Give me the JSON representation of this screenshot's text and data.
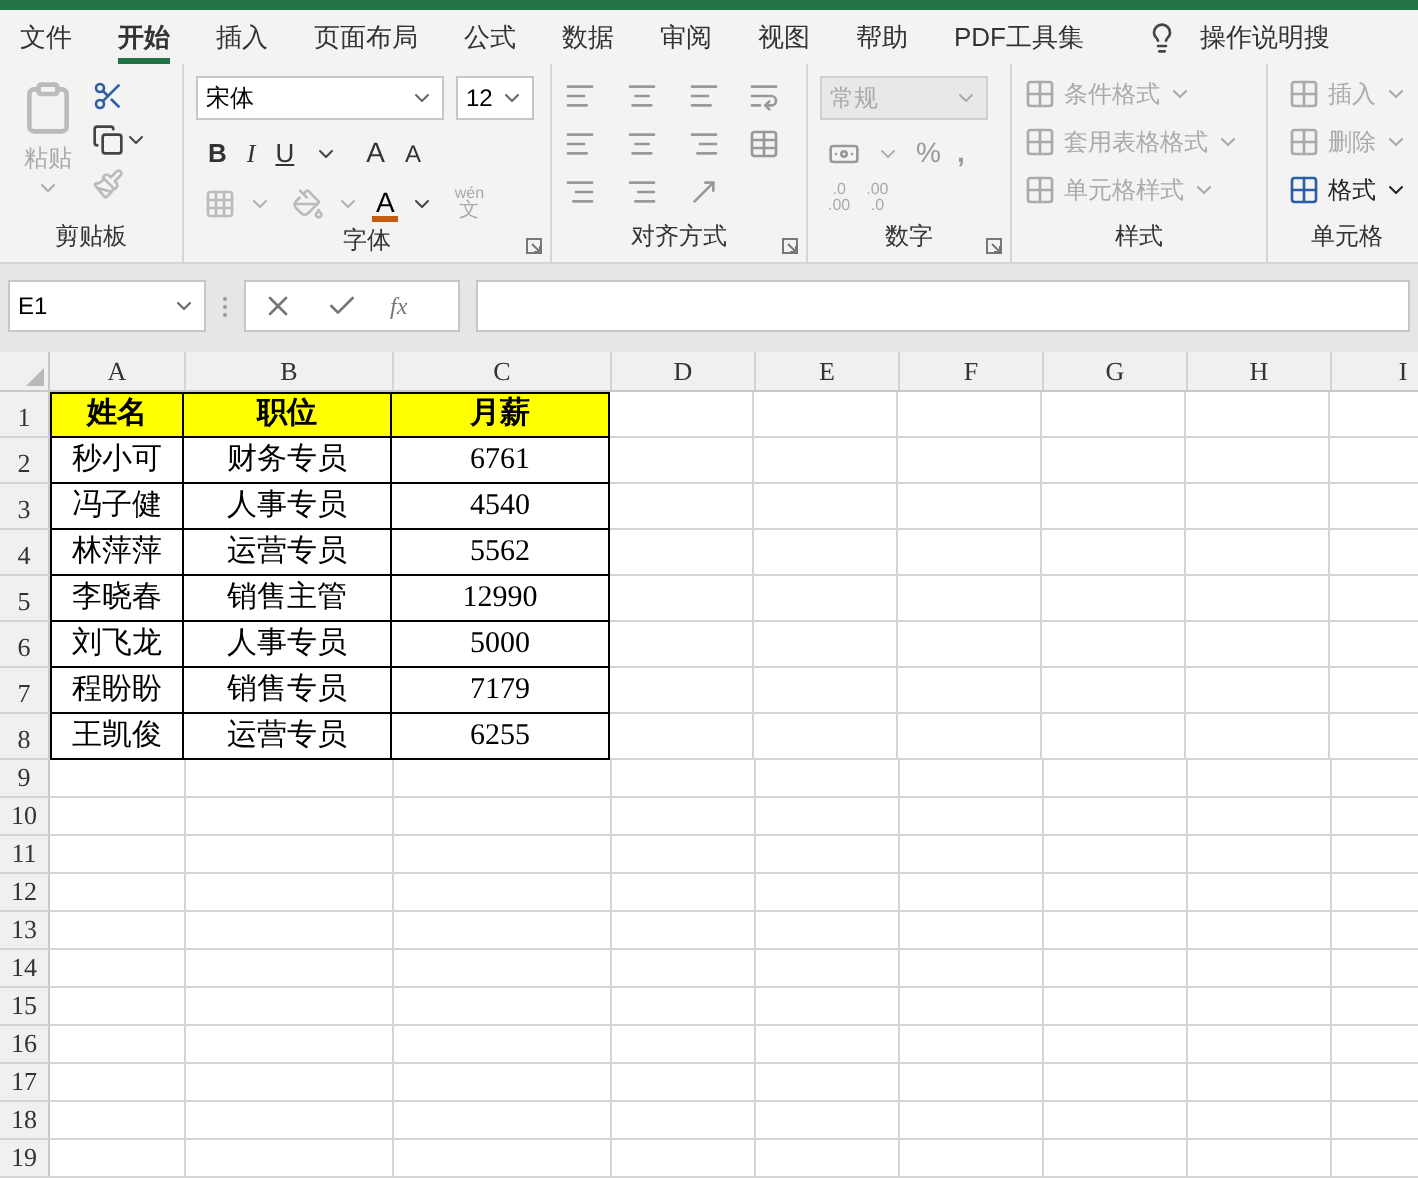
{
  "tabs": [
    {
      "label": "文件",
      "selected": false
    },
    {
      "label": "开始",
      "selected": true
    },
    {
      "label": "插入",
      "selected": false
    },
    {
      "label": "页面布局",
      "selected": false
    },
    {
      "label": "公式",
      "selected": false
    },
    {
      "label": "数据",
      "selected": false
    },
    {
      "label": "审阅",
      "selected": false
    },
    {
      "label": "视图",
      "selected": false
    },
    {
      "label": "帮助",
      "selected": false
    },
    {
      "label": "PDF工具集",
      "selected": false
    }
  ],
  "tell_me": "操作说明搜",
  "ribbon": {
    "clipboard": {
      "label": "剪贴板",
      "paste": "粘贴"
    },
    "font": {
      "label": "字体",
      "font_name": "宋体",
      "font_size": "12",
      "bold": "B",
      "italic": "I",
      "underline": "U",
      "grow": "A",
      "shrink": "A",
      "font_color": "A",
      "phonetic_top": "wén",
      "phonetic_bottom": "文"
    },
    "alignment": {
      "label": "对齐方式"
    },
    "number": {
      "label": "数字",
      "format": "常规",
      "percent": "%",
      "comma": ",",
      "increase_decimal": [
        ".0",
        ".00"
      ],
      "decrease_decimal": [
        ".00",
        ".0"
      ]
    },
    "styles": {
      "label": "样式",
      "items": [
        {
          "label": "条件格式",
          "disabled": true
        },
        {
          "label": "套用表格格式",
          "disabled": true
        },
        {
          "label": "单元格样式",
          "disabled": true
        }
      ]
    },
    "cells": {
      "label": "单元格",
      "items": [
        {
          "label": "插入",
          "disabled": true
        },
        {
          "label": "删除",
          "disabled": true
        },
        {
          "label": "格式",
          "disabled": false
        }
      ]
    }
  },
  "formula_bar": {
    "name_box": "E1",
    "fx": "fx"
  },
  "sheet": {
    "columns": [
      "A",
      "B",
      "C",
      "D",
      "E",
      "F",
      "G",
      "H",
      "I"
    ],
    "rows": [
      {
        "number": "1",
        "kind": "header",
        "cells": [
          "姓名",
          "职位",
          "月薪"
        ]
      },
      {
        "number": "2",
        "kind": "data",
        "cells": [
          "秒小可",
          "财务专员",
          "6761"
        ]
      },
      {
        "number": "3",
        "kind": "data",
        "cells": [
          "冯子健",
          "人事专员",
          "4540"
        ]
      },
      {
        "number": "4",
        "kind": "data",
        "cells": [
          "林萍萍",
          "运营专员",
          "5562"
        ]
      },
      {
        "number": "5",
        "kind": "data",
        "cells": [
          "李晓春",
          "销售主管",
          "12990"
        ]
      },
      {
        "number": "6",
        "kind": "data",
        "cells": [
          "刘飞龙",
          "人事专员",
          "5000"
        ]
      },
      {
        "number": "7",
        "kind": "data",
        "cells": [
          "程盼盼",
          "销售专员",
          "7179"
        ]
      },
      {
        "number": "8",
        "kind": "data",
        "cells": [
          "王凯俊",
          "运营专员",
          "6255"
        ]
      },
      {
        "number": "9",
        "kind": "empty"
      },
      {
        "number": "10",
        "kind": "empty"
      },
      {
        "number": "11",
        "kind": "empty"
      },
      {
        "number": "12",
        "kind": "empty"
      },
      {
        "number": "13",
        "kind": "empty"
      },
      {
        "number": "14",
        "kind": "empty"
      },
      {
        "number": "15",
        "kind": "empty"
      },
      {
        "number": "16",
        "kind": "empty"
      },
      {
        "number": "17",
        "kind": "empty"
      },
      {
        "number": "18",
        "kind": "empty"
      },
      {
        "number": "19",
        "kind": "empty"
      }
    ]
  }
}
